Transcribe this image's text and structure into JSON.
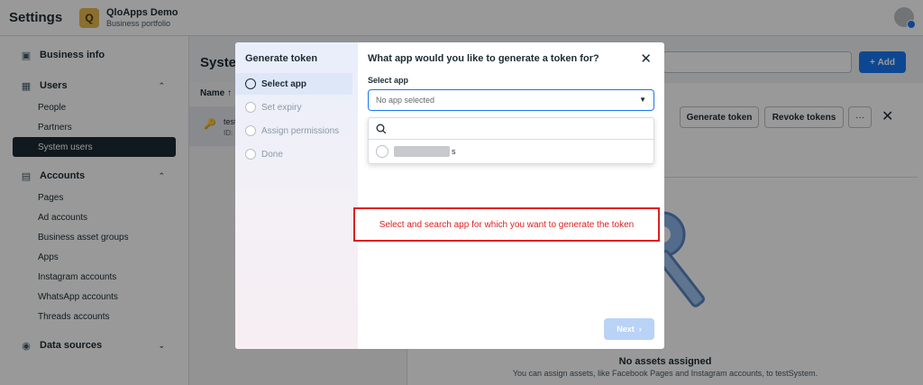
{
  "topbar": {
    "title": "Settings",
    "portfolio_logo_letter": "Q",
    "portfolio_name": "QloApps Demo",
    "portfolio_subtitle": "Business portfolio"
  },
  "sidebar": {
    "business_info": "Business info",
    "users_section": "Users",
    "users_items": [
      "People",
      "Partners",
      "System users"
    ],
    "accounts_section": "Accounts",
    "accounts_items": [
      "Pages",
      "Ad accounts",
      "Business asset groups",
      "Apps",
      "Instagram accounts",
      "WhatsApp accounts",
      "Threads accounts"
    ],
    "data_sources_section": "Data sources"
  },
  "main": {
    "title": "System",
    "add_label": "Add",
    "list_header": "Name",
    "row_name": "test",
    "row_id": "ID:",
    "generate_token_label": "Generate token",
    "revoke_tokens_label": "Revoke tokens",
    "more_label": "···",
    "no_assets_title": "No assets assigned",
    "no_assets_desc": "You can assign assets, like Facebook Pages and Instagram accounts, to testSystem."
  },
  "modal": {
    "left_title": "Generate token",
    "steps": [
      "Select app",
      "Set expiry",
      "Assign permissions",
      "Done"
    ],
    "title": "What app would you like to generate a token for?",
    "select_label": "Select app",
    "select_value": "No app selected",
    "option_suffix": "s",
    "annotation": "Select and search app for which you want to generate the token",
    "next_label": "Next"
  },
  "colors": {
    "accent": "#1877f2",
    "annotation_red": "#e01e1e",
    "sidebar_active": "#1c2b33"
  }
}
